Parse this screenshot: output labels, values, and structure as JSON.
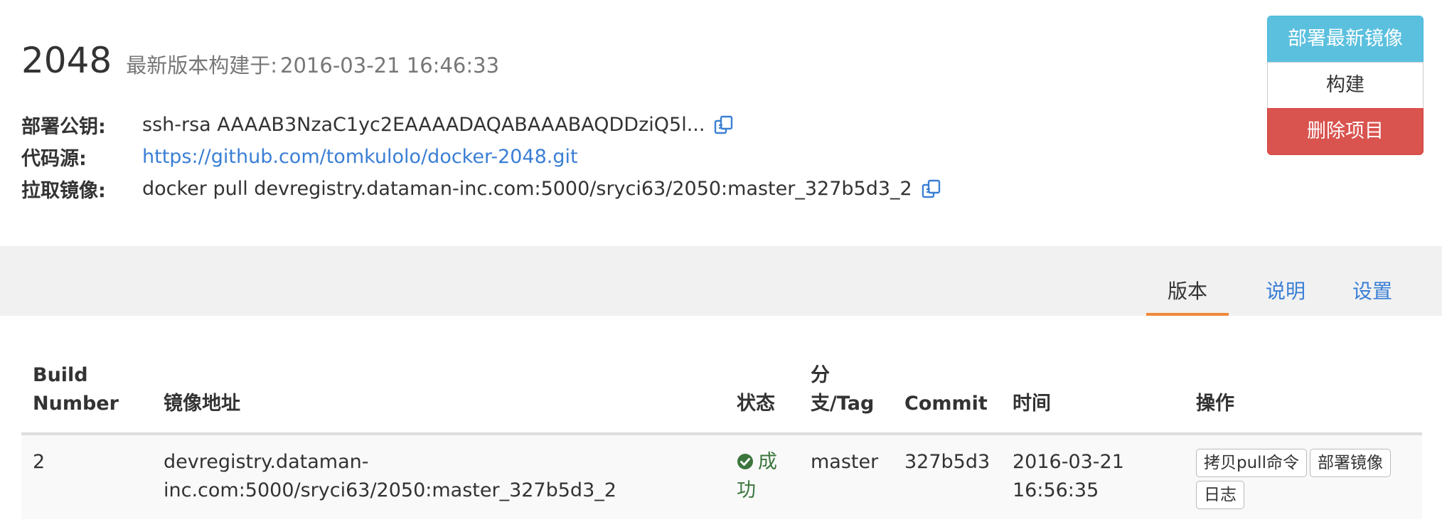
{
  "project": {
    "name": "2048",
    "built_label": "最新版本构建于:",
    "built_time": "2016-03-21 16:46:33"
  },
  "info": {
    "deploy_key_label": "部署公钥:",
    "deploy_key_value": "ssh-rsa AAAAB3NzaC1yc2EAAAADAQABAAABAQDDziQ5l...",
    "code_source_label": "代码源:",
    "code_source_url": "https://github.com/tomkulolo/docker-2048.git",
    "pull_image_label": "拉取镜像:",
    "pull_image_cmd": "docker pull devregistry.dataman-inc.com:5000/sryci63/2050:master_327b5d3_2"
  },
  "actions": {
    "deploy_latest": "部署最新镜像",
    "build": "构建",
    "delete_project": "删除项目"
  },
  "tabs": [
    {
      "label": "版本",
      "active": true
    },
    {
      "label": "说明",
      "active": false
    },
    {
      "label": "设置",
      "active": false
    }
  ],
  "table": {
    "headers": {
      "build_number": "Build Number",
      "image_address": "镜像地址",
      "status": "状态",
      "branch_tag": "分支/Tag",
      "commit": "Commit",
      "time": "时间",
      "operations": "操作"
    },
    "rows": [
      {
        "build_number": "2",
        "image_address": "devregistry.dataman-inc.com:5000/sryci63/2050:master_327b5d3_2",
        "status": "成功",
        "branch_tag": "master",
        "commit": "327b5d3",
        "time": "2016-03-21 16:56:35",
        "op_copy_pull": "拷贝pull命令",
        "op_deploy_image": "部署镜像",
        "op_log": "日志"
      }
    ]
  },
  "colors": {
    "deploy_button": "#5bc0de",
    "delete_button": "#d9534f",
    "link": "#3a7fd5",
    "tab_underline": "#f0883a",
    "success": "#3c763d",
    "tabs_band": "#f1f1f2"
  },
  "icons": {
    "copy": "copy-icon",
    "success": "check-circle-icon"
  }
}
